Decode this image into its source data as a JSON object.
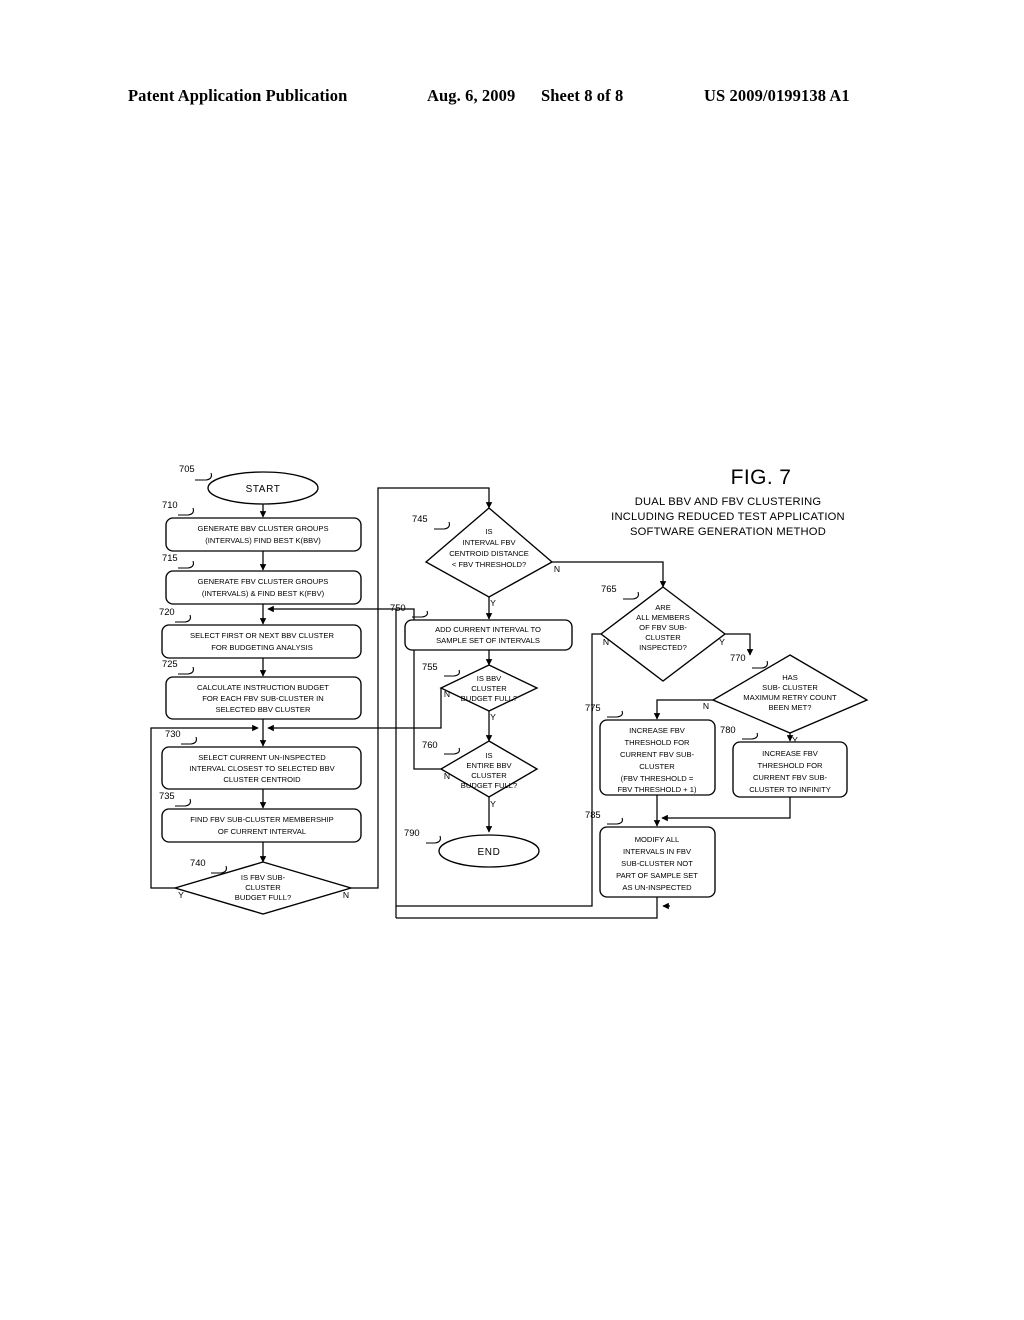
{
  "header": {
    "publication": "Patent Application Publication",
    "date": "Aug. 6, 2009",
    "sheet": "Sheet 8 of 8",
    "number": "US 2009/0199138 A1"
  },
  "figure": {
    "label": "FIG. 7",
    "subtitle_line1": "DUAL BBV AND FBV CLUSTERING",
    "subtitle_line2": "INCLUDING REDUCED TEST APPLICATION",
    "subtitle_line3": "SOFTWARE GENERATION METHOD"
  },
  "nodes": {
    "n705": {
      "ref": "705",
      "type": "terminator",
      "lines": [
        "START"
      ]
    },
    "n710": {
      "ref": "710",
      "type": "process",
      "lines": [
        "GENERATE BBV CLUSTER GROUPS",
        "(INTERVALS) FIND BEST K(BBV)"
      ]
    },
    "n715": {
      "ref": "715",
      "type": "process",
      "lines": [
        "GENERATE FBV CLUSTER GROUPS",
        "(INTERVALS) & FIND BEST K(FBV)"
      ]
    },
    "n720": {
      "ref": "720",
      "type": "process",
      "lines": [
        "SELECT FIRST OR NEXT BBV CLUSTER",
        "FOR BUDGETING ANALYSIS"
      ]
    },
    "n725": {
      "ref": "725",
      "type": "process",
      "lines": [
        "CALCULATE INSTRUCTION BUDGET",
        "FOR EACH FBV SUB-CLUSTER IN",
        "SELECTED BBV CLUSTER"
      ]
    },
    "n730": {
      "ref": "730",
      "type": "process",
      "lines": [
        "SELECT CURRENT UN-INSPECTED",
        "INTERVAL CLOSEST TO SELECTED BBV",
        "CLUSTER CENTROID"
      ]
    },
    "n735": {
      "ref": "735",
      "type": "process",
      "lines": [
        "FIND FBV SUB-CLUSTER MEMBERSHIP",
        "OF CURRENT INTERVAL"
      ]
    },
    "n740": {
      "ref": "740",
      "type": "decision",
      "lines": [
        "IS FBV SUB-",
        "CLUSTER",
        "BUDGET FULL?"
      ],
      "yes": "Y",
      "no": "N"
    },
    "n745": {
      "ref": "745",
      "type": "decision",
      "lines": [
        "IS",
        "INTERVAL FBV",
        "CENTROID DISTANCE",
        "< FBV THRESHOLD?"
      ],
      "yes": "Y",
      "no": "N"
    },
    "n750": {
      "ref": "750",
      "type": "process",
      "lines": [
        "ADD CURRENT INTERVAL TO",
        "SAMPLE SET OF INTERVALS"
      ]
    },
    "n755": {
      "ref": "755",
      "type": "decision",
      "lines": [
        "IS BBV",
        "CLUSTER",
        "BUDGET FULL?"
      ],
      "yes": "Y",
      "no": "N"
    },
    "n760": {
      "ref": "760",
      "type": "decision",
      "lines": [
        "IS",
        "ENTIRE BBV",
        "CLUSTER",
        "BUDGET FULL?"
      ],
      "yes": "Y",
      "no": "N"
    },
    "n765": {
      "ref": "765",
      "type": "decision",
      "lines": [
        "ARE",
        "ALL MEMBERS",
        "OF FBV SUB-",
        "CLUSTER",
        "INSPECTED?"
      ],
      "yes": "Y",
      "no": "N"
    },
    "n770": {
      "ref": "770",
      "type": "decision",
      "lines": [
        "HAS",
        "SUB- CLUSTER",
        "MAXIMUM RETRY COUNT",
        "BEEN MET?"
      ],
      "yes": "Y",
      "no": "N"
    },
    "n775": {
      "ref": "775",
      "type": "process",
      "lines": [
        "INCREASE FBV",
        "THRESHOLD FOR",
        "CURRENT FBV SUB-",
        "CLUSTER",
        "(FBV THRESHOLD =",
        "FBV THRESHOLD + 1)"
      ]
    },
    "n780": {
      "ref": "780",
      "type": "process",
      "lines": [
        "INCREASE FBV",
        "THRESHOLD FOR",
        "CURRENT FBV SUB-",
        "CLUSTER TO INFINITY"
      ]
    },
    "n785": {
      "ref": "785",
      "type": "process",
      "lines": [
        "MODIFY ALL",
        "INTERVALS IN FBV",
        "SUB-CLUSTER NOT",
        "PART OF SAMPLE SET",
        "AS UN-INSPECTED"
      ]
    },
    "n790": {
      "ref": "790",
      "type": "terminator",
      "lines": [
        "END"
      ]
    }
  },
  "colors": {
    "ink": "#000000",
    "paper": "#ffffff"
  }
}
